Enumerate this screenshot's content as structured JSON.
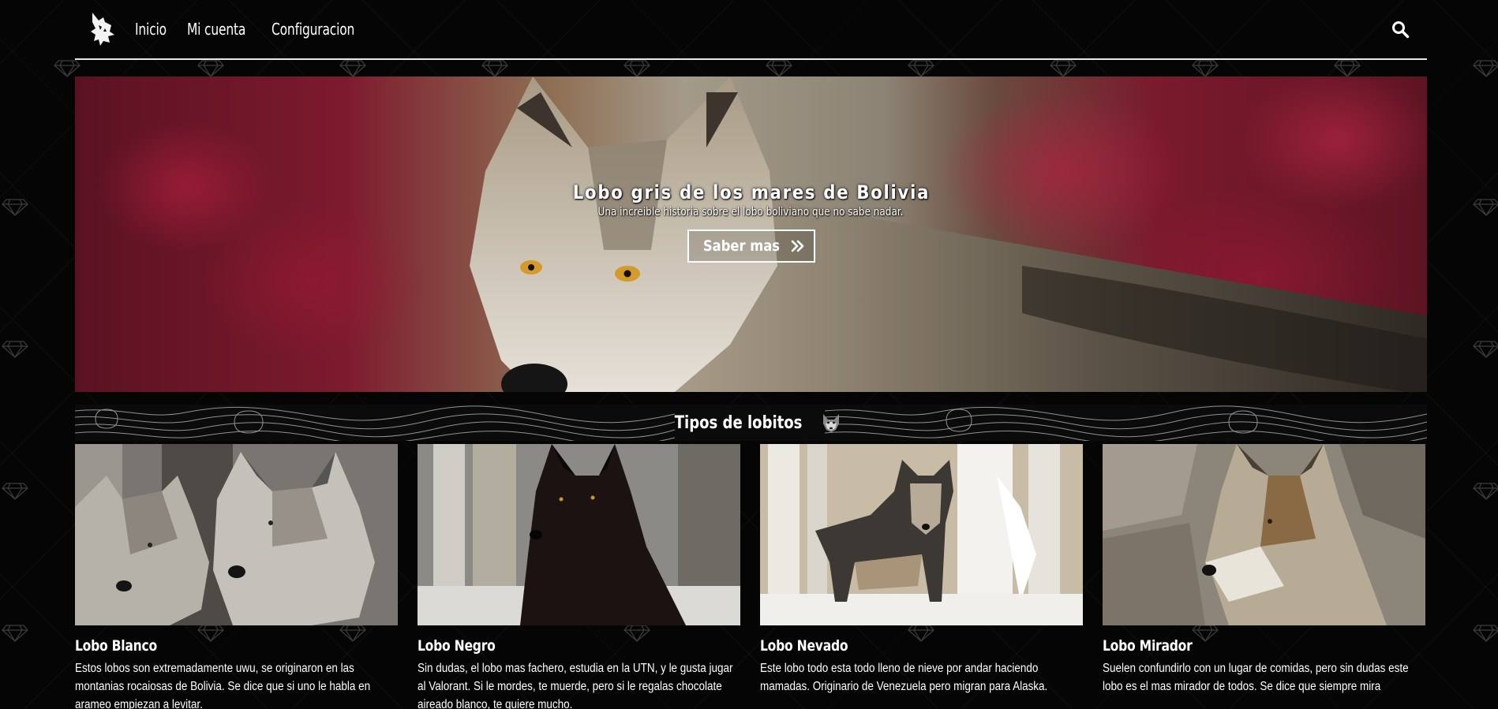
{
  "navbar": {
    "logo_label": "",
    "items": [
      {
        "label": "Inicio"
      },
      {
        "label": "Mi cuenta"
      },
      {
        "label": "Configuracion"
      }
    ],
    "search_icon": "search-icon"
  },
  "hero": {
    "title": "Lobo gris de los mares de Bolivia",
    "subtitle": "Una increible historia sobre el lobo boliviano que no sabe nadar.",
    "button_label": "Saber mas",
    "button_icon": "double-chevron-right-icon"
  },
  "section": {
    "title": "Tipos de lobitos",
    "icon": "wolf-icon"
  },
  "cards": [
    {
      "title": "Lobo Blanco",
      "text": "Estos lobos son extremadamente uwu, se originaron en las montanias rocaiosas de Bolivia. Se dice que si uno le habla en arameo empiezan a levitar."
    },
    {
      "title": "Lobo Negro",
      "text": "Sin dudas, el lobo mas fachero, estudia en la UTN, y le gusta jugar al Valorant. Si le mordes, te muerde, pero si le regalas chocolate aireado blanco, te quiere mucho."
    },
    {
      "title": "Lobo Nevado",
      "text": "Este lobo todo esta todo lleno de nieve por andar haciendo mamadas. Originario de Venezuela pero migran para Alaska."
    },
    {
      "title": "Lobo Mirador",
      "text": "Suelen confundirlo con un lugar de comidas, pero sin dudas este lobo es el mas mirador de todos. Se dice que siempre mira"
    }
  ],
  "colors": {
    "background": "#050505",
    "text": "#ffffff",
    "divider": "#e8e8e8"
  }
}
